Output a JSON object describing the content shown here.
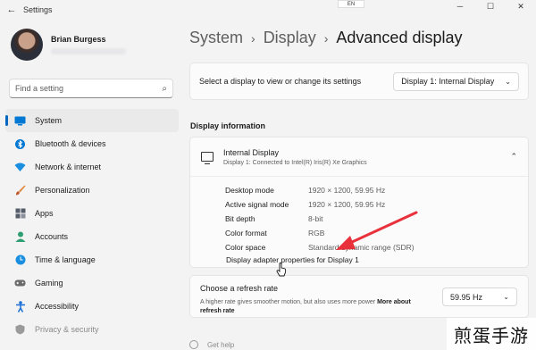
{
  "window": {
    "title": "Settings",
    "lang": "EN"
  },
  "profile": {
    "name": "Brian Burgess"
  },
  "search": {
    "placeholder": "Find a setting"
  },
  "nav": [
    {
      "label": "System",
      "icon": "monitor-icon",
      "color": "#0078d4"
    },
    {
      "label": "Bluetooth & devices",
      "icon": "bluetooth-icon",
      "color": "#0078d4"
    },
    {
      "label": "Network & internet",
      "icon": "wifi-icon",
      "color": "#1a8fe0"
    },
    {
      "label": "Personalization",
      "icon": "brush-icon",
      "color": "#e0873f"
    },
    {
      "label": "Apps",
      "icon": "apps-icon",
      "color": "#555d6b"
    },
    {
      "label": "Accounts",
      "icon": "person-icon",
      "color": "#2f9e73"
    },
    {
      "label": "Time & language",
      "icon": "globe-clock-icon",
      "color": "#1a8fe0"
    },
    {
      "label": "Gaming",
      "icon": "gamepad-icon",
      "color": "#6b6b6b"
    },
    {
      "label": "Accessibility",
      "icon": "accessibility-icon",
      "color": "#1a6fd6"
    },
    {
      "label": "Privacy & security",
      "icon": "shield-icon",
      "color": "#8a8a8a"
    }
  ],
  "breadcrumb": {
    "level1": "System",
    "level2": "Display",
    "current": "Advanced display"
  },
  "select_display": {
    "label": "Select a display to view or change its settings",
    "value": "Display 1: Internal Display"
  },
  "display_info": {
    "section_title": "Display information",
    "name": "Internal Display",
    "subtitle": "Display 1: Connected to Intel(R) Iris(R) Xe Graphics",
    "rows": [
      {
        "key": "Desktop mode",
        "value": "1920 × 1200, 59.95 Hz"
      },
      {
        "key": "Active signal mode",
        "value": "1920 × 1200, 59.95 Hz"
      },
      {
        "key": "Bit depth",
        "value": "8-bit"
      },
      {
        "key": "Color format",
        "value": "RGB"
      },
      {
        "key": "Color space",
        "value": "Standard dynamic range (SDR)"
      }
    ],
    "adapter_link": "Display adapter properties for Display 1"
  },
  "refresh": {
    "title": "Choose a refresh rate",
    "desc": "A higher rate gives smoother motion, but also uses more power",
    "more_link": "More about refresh rate",
    "value": "59.95 Hz"
  },
  "help": {
    "label": "Get help"
  },
  "watermark": "煎蛋手游",
  "annotation_color": "#e8313a"
}
